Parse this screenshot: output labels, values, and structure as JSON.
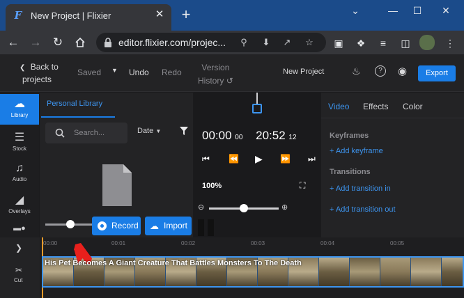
{
  "browser": {
    "tab_title": "New Project | Flixier",
    "tab_favicon": "F",
    "tab_close": "✕",
    "new_tab": "+",
    "url": "editor.flixier.com/projec...",
    "window_controls": [
      "⌄",
      "—",
      "☐",
      "✕"
    ]
  },
  "header": {
    "back_line1": "Back to",
    "back_line2": "projects",
    "saved": "Saved",
    "undo": "Undo",
    "redo": "Redo",
    "version_line1": "Version",
    "version_line2": "History",
    "project_name": "New Project",
    "export": "Export"
  },
  "rail": {
    "items": [
      {
        "label": "Library",
        "icon": "cloud-icon"
      },
      {
        "label": "Stock",
        "icon": "books-icon"
      },
      {
        "label": "Audio",
        "icon": "music-note-icon"
      },
      {
        "label": "Overlays",
        "icon": "overlays-icon"
      }
    ]
  },
  "library": {
    "tab": "Personal Library",
    "search_placeholder": "Search...",
    "sort": "Date",
    "record": "Record",
    "import": "Import"
  },
  "preview": {
    "time_current": "00:00",
    "time_current_frames": "00",
    "time_total": "20:52",
    "time_total_frames": "12",
    "zoom": "100%",
    "zoom_slider_level": 0.5
  },
  "properties": {
    "tabs": [
      "Video",
      "Effects",
      "Color"
    ],
    "keyframes_heading": "Keyframes",
    "add_keyframe": "Add keyframe",
    "transitions_heading": "Transitions",
    "add_transition_in": "Add transition in",
    "add_transition_out": "Add transition out"
  },
  "timeline": {
    "cut_label": "Cut",
    "ticks": [
      "00:00",
      "00:01",
      "00:02",
      "00:03",
      "00:04",
      "00:05"
    ],
    "clip_title": "His Pet Becomes A Giant Creature That Battles Monsters To The Death"
  },
  "colors": {
    "accent": "#1a7de6",
    "arrow": "#e8201c"
  }
}
